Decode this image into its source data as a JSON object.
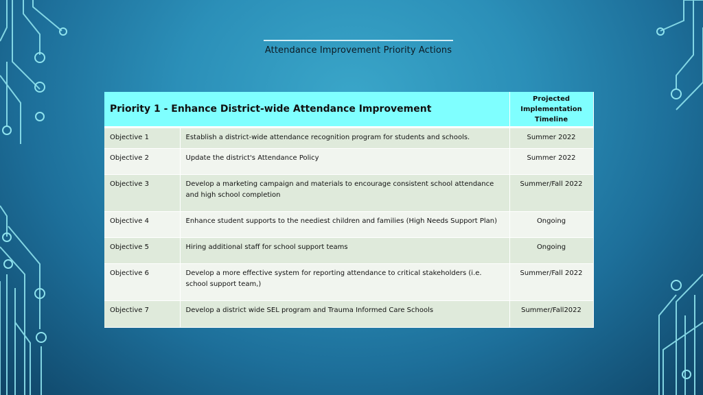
{
  "slide": {
    "title": "Attendance Improvement Priority Actions"
  },
  "table": {
    "header": {
      "priority": "Priority 1 - Enhance District-wide Attendance Improvement",
      "timeline": "Projected Implementation Timeline"
    },
    "rows": [
      {
        "objective": "Objective 1",
        "action": "Establish a district-wide attendance recognition program for students and schools.",
        "timeline": "Summer 2022"
      },
      {
        "objective": "Objective 2",
        "action": "Update the district's Attendance Policy",
        "timeline": "Summer 2022"
      },
      {
        "objective": "Objective 3",
        "action": "Develop a marketing campaign and materials to encourage consistent school attendance and high school completion",
        "timeline": "Summer/Fall 2022"
      },
      {
        "objective": "Objective 4",
        "action": "Enhance student supports to the neediest children and families (High Needs Support Plan)",
        "timeline": "Ongoing"
      },
      {
        "objective": "Objective 5",
        "action": "Hiring additional staff for school support teams",
        "timeline": "Ongoing"
      },
      {
        "objective": "Objective 6",
        "action": "Develop a more effective system for reporting attendance to critical stakeholders (i.e. school support team,)",
        "timeline": "Summer/Fall 2022"
      },
      {
        "objective": "Objective 7",
        "action": "Develop a district wide SEL program and Trauma Informed Care Schools",
        "timeline": "Summer/Fall2022"
      }
    ]
  },
  "colors": {
    "header_bg": "#7fffff",
    "row_odd": "#dfeadb",
    "row_even": "#f1f5ef",
    "circuit": "#8fe3ee"
  }
}
